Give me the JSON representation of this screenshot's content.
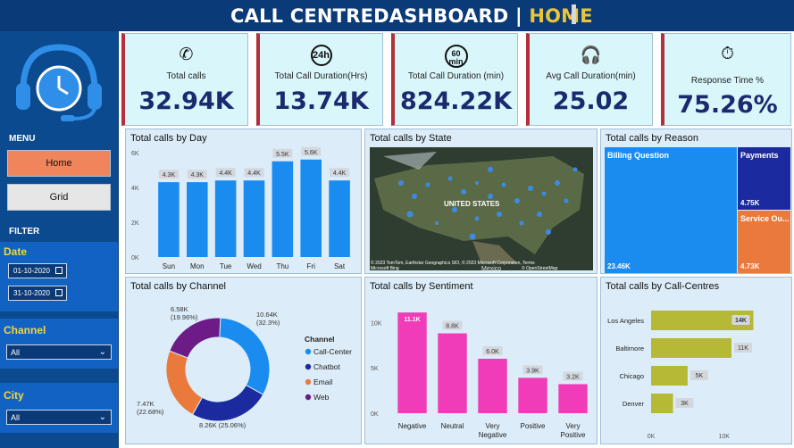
{
  "header": {
    "title_main": "CALL CENTREDASHBOARD | ",
    "title_home": "HOME"
  },
  "sidebar": {
    "menu_label": "MENU",
    "home_button": "Home",
    "grid_button": "Grid",
    "filter_label": "FILTER",
    "date_label": "Date",
    "date_from": "01-10-2020",
    "date_to": "31-10-2020",
    "channel_label": "Channel",
    "channel_value": "All",
    "city_label": "City",
    "city_value": "All"
  },
  "kpis": [
    {
      "label": "Total calls",
      "value": "32.94K",
      "icon": "phone-icon"
    },
    {
      "label": "Total Call Duration(Hrs)",
      "value": "13.74K",
      "icon": "24h-clock-icon"
    },
    {
      "label": "Total Call Duration (min)",
      "value": "824.22K",
      "icon": "60-min-icon"
    },
    {
      "label": "Avg Call Duration(min)",
      "value": "25.02",
      "icon": "headset-icon"
    },
    {
      "label": "Response Time %",
      "value": "75.26%",
      "icon": "stopwatch-icon"
    }
  ],
  "panels": {
    "by_day": "Total calls by Day",
    "by_state": "Total calls by State",
    "by_reason": "Total calls by Reason",
    "by_channel": "Total calls by Channel",
    "by_sentiment": "Total calls by Sentiment",
    "by_centre": "Total calls by Call-Centres"
  },
  "map": {
    "label": "UNITED STATES",
    "attribution": "© 2023 TomTom, Earthstar Geographics SIO, © 2023 Microsoft Corporation, Terms",
    "ms_bing": "Microsoft Bing",
    "osm": "© OpenStreetMap",
    "mexico": "Mexico"
  },
  "chart_data": [
    {
      "type": "bar",
      "title": "Total calls by Day",
      "categories": [
        "Sun",
        "Mon",
        "Tue",
        "Wed",
        "Thu",
        "Fri",
        "Sat"
      ],
      "values": [
        4300,
        4300,
        4400,
        4400,
        5500,
        5600,
        4400
      ],
      "labels": [
        "4.3K",
        "4.3K",
        "4.4K",
        "4.4K",
        "5.5K",
        "5.6K",
        "4.4K"
      ],
      "yticks": [
        "0K",
        "2K",
        "4K",
        "6K"
      ],
      "ylim": [
        0,
        6000
      ],
      "color": "#1a8cf0"
    },
    {
      "type": "treemap",
      "title": "Total calls by Reason",
      "items": [
        {
          "name": "Billing Question",
          "value": "23.46K",
          "color": "#1a8cf0"
        },
        {
          "name": "Payments",
          "value": "4.75K",
          "color": "#1b2a9e"
        },
        {
          "name": "Service Ou...",
          "value": "4.73K",
          "color": "#ea7a3c"
        }
      ]
    },
    {
      "type": "pie",
      "title": "Total calls by Channel",
      "legend_title": "Channel",
      "slices": [
        {
          "name": "Call-Center",
          "value": 10640,
          "label": "10.64K",
          "pct": "(32.3%)",
          "color": "#1a8cf0"
        },
        {
          "name": "Chatbot",
          "value": 8260,
          "label": "8.26K (25.06%)",
          "pct": "",
          "color": "#1b2a9e"
        },
        {
          "name": "Email",
          "value": 7470,
          "label": "7.47K",
          "pct": "(22.68%)",
          "color": "#ea7a3c"
        },
        {
          "name": "Web",
          "value": 6580,
          "label": "6.58K",
          "pct": "(19.96%)",
          "color": "#6d1b86"
        }
      ]
    },
    {
      "type": "bar",
      "title": "Total calls by Sentiment",
      "categories": [
        "Negative",
        "Neutral",
        "Very Negative",
        "Positive",
        "Very Positive"
      ],
      "values": [
        11100,
        8800,
        6000,
        3900,
        3200
      ],
      "labels": [
        "11.1K",
        "8.8K",
        "6.0K",
        "3.9K",
        "3.2K"
      ],
      "yticks": [
        "0K",
        "5K",
        "10K"
      ],
      "ylim": [
        0,
        12000
      ],
      "color": "#f03cb8"
    },
    {
      "type": "bar",
      "orientation": "horizontal",
      "title": "Total calls by Call-Centres",
      "categories": [
        "Los Angeles",
        "Baltimore",
        "Chicago",
        "Denver"
      ],
      "values": [
        14000,
        11000,
        5000,
        3000
      ],
      "labels": [
        "14K",
        "11K",
        "5K",
        "3K"
      ],
      "xticks": [
        "0K",
        "10K"
      ],
      "xlim": [
        0,
        17000
      ],
      "color": "#b5b935"
    }
  ]
}
